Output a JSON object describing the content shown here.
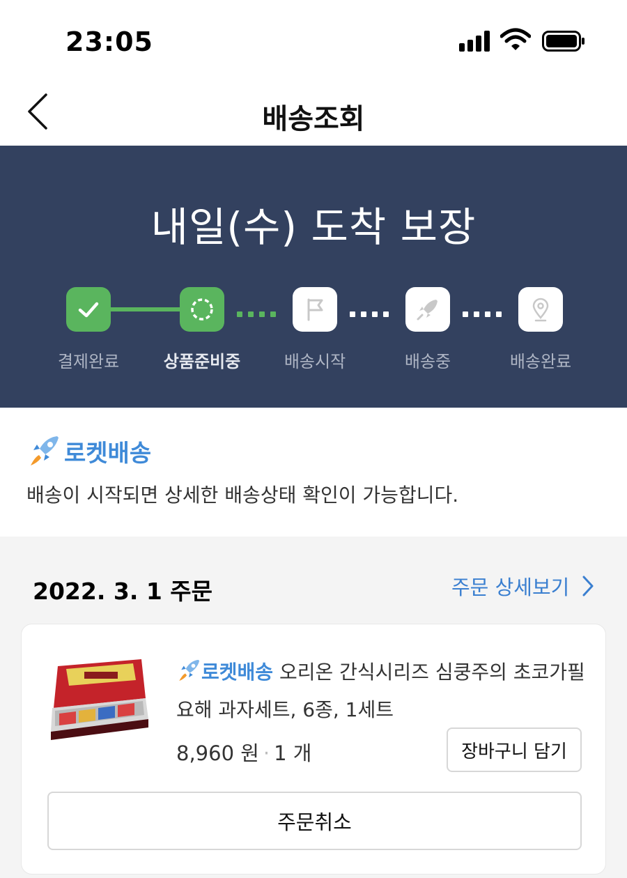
{
  "status_bar": {
    "time": "23:05",
    "signal_icon": "cellular-signal-icon",
    "wifi_icon": "wifi-icon",
    "battery_icon": "battery-icon"
  },
  "nav": {
    "title": "배송조회",
    "back_icon": "chevron-left-icon"
  },
  "hero": {
    "title": "내일(수) 도착 보장",
    "steps": [
      {
        "label": "결제완료",
        "state": "done",
        "icon": "check-icon"
      },
      {
        "label": "상품준비중",
        "state": "current",
        "icon": "loading-circle-icon"
      },
      {
        "label": "배송시작",
        "state": "pending",
        "icon": "flag-icon"
      },
      {
        "label": "배송중",
        "state": "pending",
        "icon": "rocket-icon"
      },
      {
        "label": "배송완료",
        "state": "pending",
        "icon": "location-pin-icon"
      }
    ],
    "colors": {
      "background": "#33415f",
      "done": "#5ab55e"
    }
  },
  "rocket": {
    "label": "로켓배송",
    "note": "배송이 시작되면 상세한 배송상태 확인이 가능합니다."
  },
  "order": {
    "date": "2022. 3. 1 주문",
    "detail_link": "주문 상세보기",
    "item": {
      "badge": "로켓배송",
      "name": "오리온 간식시리즈 심쿵주의 초코가필요해 과자세트, 6종, 1세트",
      "price": "8,960 원",
      "separator": "·",
      "quantity": "1 개",
      "cart_button": "장바구니 담기"
    },
    "cancel_button": "주문취소"
  }
}
